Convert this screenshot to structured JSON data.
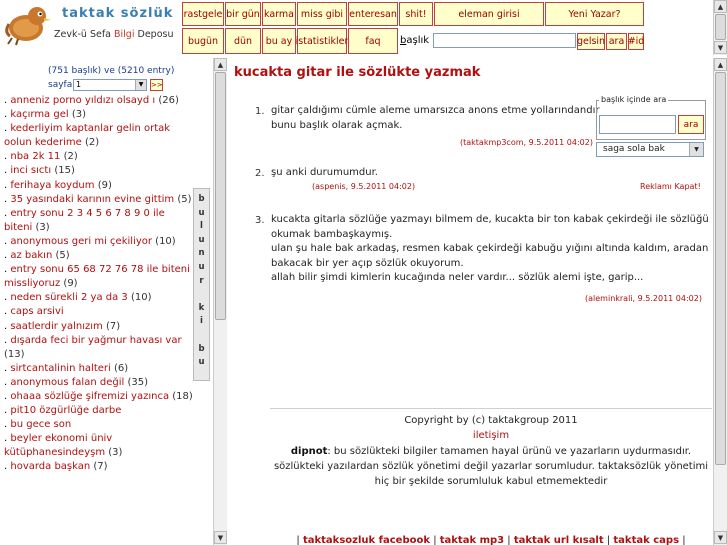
{
  "logo": {
    "title": "taktak sözlük",
    "subtitle_pre": "Zevk-ü Sefa ",
    "subtitle_hl": "Bilgi",
    "subtitle_post": " Deposu"
  },
  "nav_row1": [
    "rastgele",
    "bir gün",
    "karma",
    "miss gibi",
    "enteresan",
    "shit!",
    "eleman girisi",
    "Yeni Yazar?"
  ],
  "nav_row2": [
    "bugün",
    "dün",
    "bu ay",
    "istatistikler",
    "faq"
  ],
  "search": {
    "label_underlined": "b",
    "label_rest": "aşlık",
    "value": "",
    "buttons": [
      "gelsin",
      "ara",
      "#id"
    ]
  },
  "left": {
    "stats": "(751 başlık) ve (5210 entry)",
    "page_label": "sayfa",
    "page_value": "1",
    "page_go": ">>",
    "topics": [
      {
        "title": "anneniz porno yıldızı olsayd ı",
        "count": "(26)"
      },
      {
        "title": "kaçırma gel",
        "count": "(3)"
      },
      {
        "title": "kederliyim kaptanlar gelin ortak oolun kederime",
        "count": "(2)"
      },
      {
        "title": "nba 2k 11",
        "count": "(2)"
      },
      {
        "title": "inci sıctı",
        "count": "(15)"
      },
      {
        "title": "ferihaya koydum",
        "count": "(9)"
      },
      {
        "title": "35 yasındaki karının evine gittim",
        "count": "(5)"
      },
      {
        "title": "entry sonu 2 3 4 5 6 7 8 9 0 ile biteni",
        "count": "(3)"
      },
      {
        "title": "anonymous geri mi çekiliyor",
        "count": "(10)"
      },
      {
        "title": "az bakın",
        "count": "(5)"
      },
      {
        "title": "entry sonu 65 68 72 76 78 ile biteni missliyoruz",
        "count": "(9)"
      },
      {
        "title": "neden sürekli 2 ya da 3",
        "count": "(10)"
      },
      {
        "title": "caps arsivi",
        "count": ""
      },
      {
        "title": "saatlerdir yalnızım",
        "count": "(7)"
      },
      {
        "title": "dışarda feci bir yağmur havası var",
        "count": "(13)"
      },
      {
        "title": "sirtcantalinin halteri",
        "count": "(6)"
      },
      {
        "title": "anonymous falan değil",
        "count": "(35)"
      },
      {
        "title": "ohaaa sözlüğe şifremizi yazınca",
        "count": "(18)"
      },
      {
        "title": "pit10 özgürlüğe darbe",
        "count": ""
      },
      {
        "title": "bu gece son",
        "count": ""
      },
      {
        "title": "beyler ekonomi üniv kütüphanesindeyşm",
        "count": "(3)"
      },
      {
        "title": "hovarda başkan",
        "count": "(7)"
      }
    ],
    "side_tab": [
      "b",
      "u",
      "l",
      "u",
      "n",
      "u",
      "r",
      "",
      "k",
      "i",
      "",
      "b",
      "u"
    ]
  },
  "topic_title": "kucakta gitar ile sözlükte yazmak",
  "entries": [
    {
      "num": "1.",
      "lines": [
        "gitar çaldığımı cümle aleme umarsızca anons etme yollarındandır",
        "bunu başlık olarak açmak."
      ],
      "author": "taktakmp3com",
      "date": "9.5.2011 04:02"
    },
    {
      "num": "2.",
      "lines": [
        "şu anki durumumdur."
      ],
      "author": "aspenis",
      "date": "9.5.2011 04:02"
    },
    {
      "num": "3.",
      "lines": [
        "kucakta gitarla sözlüğe yazmayı bilmem de, kucakta bir ton kabak çekirdeği ile sözlüğü",
        "okumak bambaşkaymış.",
        "ulan şu hale bak arkadaş, resmen kabak çekirdeği kabuğu yığını altında kaldım, aradan",
        "bakacak bir yer açıp sözlük okuyorum.",
        "allah bilir şimdi kimlerin kucağında neler vardır... sözlük alemi işte, garip..."
      ],
      "author": "aleminkrali",
      "date": "9.5.2011 04:02"
    }
  ],
  "side_box": {
    "legend": "başlık içinde ara",
    "button": "ara",
    "select": "saga sola bak",
    "reklam": "Reklamı Kapat!"
  },
  "footer": {
    "copyright": "Copyright by (c) taktakgroup 2011",
    "contact": "iletişim",
    "dipnot_label": "dipnot",
    "dipnot_text": ": bu sözlükteki bilgiler tamamen hayal ürünü ve yazarların uydurmasıdır.",
    "line2": "sözlükteki yazılardan sözlük yönetimi değil yazarlar sorumludur. taktaksözlük yönetimi",
    "line3": "hiç bir şekilde sorumluluk kabul etmemektedir",
    "links": [
      "taktaksozluk facebook",
      "taktak mp3",
      "taktak url kısalt",
      "taktak caps"
    ]
  }
}
